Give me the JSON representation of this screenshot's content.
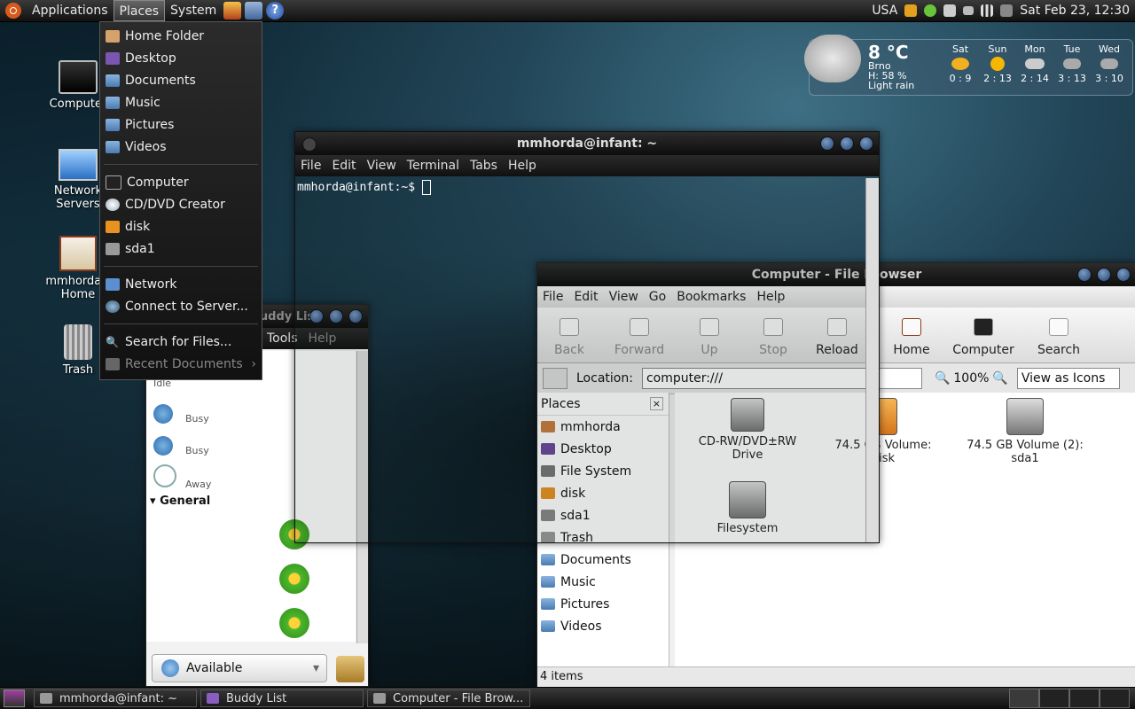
{
  "top_panel": {
    "menus": [
      "Applications",
      "Places",
      "System"
    ],
    "keyboard_layout": "USA",
    "clock": "Sat Feb 23, 12:30"
  },
  "desktop_icons": [
    {
      "label": "Computer",
      "icon": "computer-icon"
    },
    {
      "label": "Network Servers",
      "icon": "network-icon"
    },
    {
      "label": "mmhorda's Home",
      "icon": "home-icon"
    },
    {
      "label": "Trash",
      "icon": "trash-icon"
    }
  ],
  "weather": {
    "temp": "8 °C",
    "city": "Brno",
    "humidity": "H: 58 %",
    "condition": "Light rain",
    "forecast": [
      {
        "day": "Sat",
        "range": "0 : 9"
      },
      {
        "day": "Sun",
        "range": "2 : 13"
      },
      {
        "day": "Mon",
        "range": "2 : 14"
      },
      {
        "day": "Tue",
        "range": "3 : 13"
      },
      {
        "day": "Wed",
        "range": "3 : 10"
      }
    ]
  },
  "places_menu": {
    "items": [
      {
        "label": "Home Folder"
      },
      {
        "label": "Desktop"
      },
      {
        "label": "Documents"
      },
      {
        "label": "Music"
      },
      {
        "label": "Pictures"
      },
      {
        "label": "Videos"
      },
      {
        "label": "Computer"
      },
      {
        "label": "CD/DVD Creator"
      },
      {
        "label": "disk"
      },
      {
        "label": "sda1"
      },
      {
        "label": "Network"
      },
      {
        "label": "Connect to Server..."
      },
      {
        "label": "Search for Files..."
      },
      {
        "label": "Recent Documents"
      }
    ]
  },
  "terminal": {
    "title": "mmhorda@infant: ~",
    "menus": [
      "File",
      "Edit",
      "View",
      "Terminal",
      "Tabs",
      "Help"
    ],
    "prompt": "mmhorda@infant:~$"
  },
  "buddy_list": {
    "title": "Buddy List",
    "menus": [
      "Tools",
      "Help"
    ],
    "statuses": [
      "Idle",
      "Busy",
      "Busy",
      "Away"
    ],
    "group": "General",
    "status_selector": "Available"
  },
  "file_browser": {
    "title": "Computer - File Browser",
    "menus": [
      "File",
      "Edit",
      "View",
      "Go",
      "Bookmarks",
      "Help"
    ],
    "toolbar": [
      "Back",
      "Forward",
      "Up",
      "Stop",
      "Reload",
      "Home",
      "Computer",
      "Search"
    ],
    "location_label": "Location:",
    "location_value": "computer:///",
    "zoom": "100%",
    "view_mode": "View as Icons",
    "sidebar_header": "Places",
    "sidebar": [
      "mmhorda",
      "Desktop",
      "File System",
      "disk",
      "sda1",
      "Trash",
      "Documents",
      "Music",
      "Pictures",
      "Videos"
    ],
    "items": [
      {
        "label": "CD-RW/DVD±RW Drive"
      },
      {
        "label": "74.5 GB Volume: disk"
      },
      {
        "label": "74.5 GB Volume (2): sda1"
      },
      {
        "label": "Filesystem"
      }
    ],
    "status": "4 items"
  },
  "taskbar": [
    {
      "label": "mmhorda@infant: ~"
    },
    {
      "label": "Buddy List"
    },
    {
      "label": "Computer - File Brow..."
    }
  ]
}
